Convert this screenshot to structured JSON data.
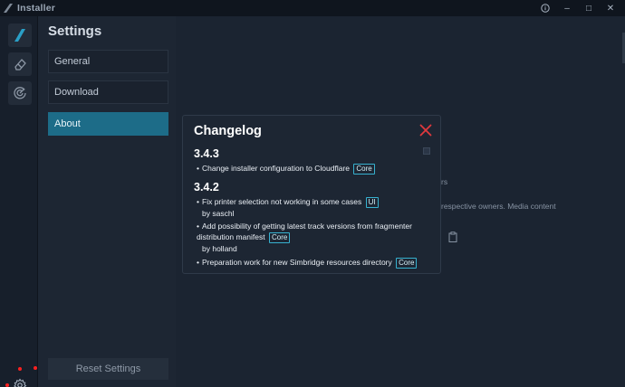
{
  "titlebar": {
    "title": "Installer",
    "controls": {
      "info_icon": "info-circle-icon",
      "minimize": "–",
      "maximize": "□",
      "close": "✕"
    }
  },
  "sidebar": {
    "items": [
      {
        "icon": "flybywire-logo-icon"
      },
      {
        "icon": "eraser-icon"
      },
      {
        "icon": "radar-icon"
      }
    ],
    "bottom_icon": "gear-icon"
  },
  "settings": {
    "title": "Settings",
    "menu": [
      {
        "label": "General",
        "active": false
      },
      {
        "label": "Download",
        "active": false
      },
      {
        "label": "About",
        "active": true
      }
    ],
    "reset_label": "Reset Settings"
  },
  "background": {
    "line1": "rs",
    "line2": "respective owners. Media content"
  },
  "changelog": {
    "title": "Changelog",
    "versions": [
      {
        "version": "3.4.3",
        "entries": [
          {
            "text": "Change installer configuration to Cloudflare",
            "tag": "Core",
            "author": ""
          }
        ]
      },
      {
        "version": "3.4.2",
        "entries": [
          {
            "text": "Fix printer selection not working in some cases",
            "tag": "UI",
            "author": "by saschl"
          },
          {
            "text": "Add possibility of getting latest track versions from fragmenter distribution manifest",
            "tag": "Core",
            "author": "by holland"
          },
          {
            "text": "Preparation work for new Simbridge resources directory",
            "tag": "Core",
            "author": ""
          }
        ]
      }
    ]
  },
  "colors": {
    "accent": "#1d6c88",
    "tag_border": "#37b1cf",
    "close": "#e0393e",
    "annotation": "#ff2020"
  }
}
